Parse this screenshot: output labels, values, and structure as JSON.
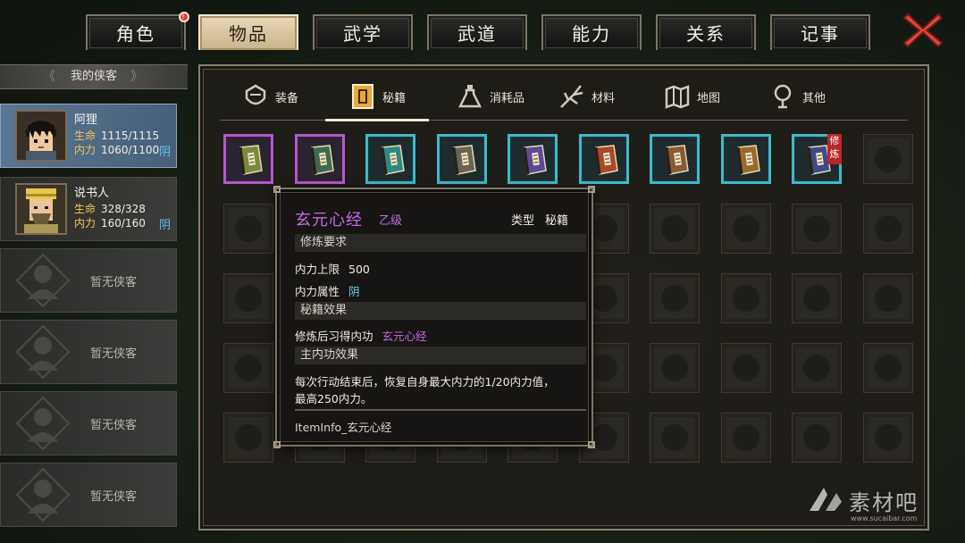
{
  "top_tabs": [
    {
      "label": "角色",
      "badge": "!"
    },
    {
      "label": "物品"
    },
    {
      "label": "武学"
    },
    {
      "label": "武道"
    },
    {
      "label": "能力"
    },
    {
      "label": "关系"
    },
    {
      "label": "记事"
    }
  ],
  "active_top_tab": "物品",
  "close_icon": "close-x-icon",
  "characters": {
    "header": "我的侠客",
    "members": [
      {
        "name": "阿狸",
        "hp_label": "生命",
        "hp": "1115/1115",
        "mp_label": "内力",
        "mp": "1060/1100",
        "attr": "阴",
        "selected": true
      },
      {
        "name": "说书人",
        "hp_label": "生命",
        "hp": "328/328",
        "mp_label": "内力",
        "mp": "160/160",
        "attr": "阴"
      }
    ],
    "empty_label": "暂无侠客",
    "empty_count": 4
  },
  "categories": [
    {
      "label": "装备",
      "icon": "equipment-icon"
    },
    {
      "label": "秘籍",
      "icon": "manual-icon"
    },
    {
      "label": "消耗品",
      "icon": "potion-icon"
    },
    {
      "label": "材料",
      "icon": "herb-icon"
    },
    {
      "label": "地图",
      "icon": "map-icon"
    },
    {
      "label": "其他",
      "icon": "misc-icon"
    }
  ],
  "active_category": "秘籍",
  "inventory": {
    "items": [
      {
        "rarity": "purple",
        "book_color": "#7a8a3c"
      },
      {
        "rarity": "purple",
        "book_color": "#3c6a52"
      },
      {
        "rarity": "cyan",
        "book_color": "#2a8a86"
      },
      {
        "rarity": "cyan",
        "book_color": "#6a6458"
      },
      {
        "rarity": "cyan",
        "book_color": "#5a4a9a"
      },
      {
        "rarity": "cyan",
        "book_color": "#a8482c"
      },
      {
        "rarity": "cyan",
        "book_color": "#8a5a34"
      },
      {
        "rarity": "cyan",
        "book_color": "#9a6a2c"
      },
      {
        "rarity": "cyan",
        "book_color": "#3c4a8a",
        "tag": "修炼"
      }
    ],
    "columns": 10,
    "rows": 5
  },
  "tooltip": {
    "title": "玄元心经",
    "grade": "乙级",
    "type_label": "类型",
    "type_value": "秘籍",
    "section_requirements": "修炼要求",
    "req_max_mp_label": "内力上限",
    "req_max_mp_value": "500",
    "req_attr_label": "内力属性",
    "req_attr_value": "阴",
    "section_effect": "秘籍效果",
    "effect_label": "修炼后习得内功",
    "effect_value": "玄元心经",
    "section_main": "主内功效果",
    "main_desc_line1": "每次行动结束后，恢复自身最大内力的1/20内力值，",
    "main_desc_line2": "最高250内力。",
    "info_key": "ItemInfo_玄元心经"
  },
  "watermark": {
    "text": "素材吧",
    "sub": "www.sucaibar.com"
  },
  "colors": {
    "rarity_purple": "#b05ac8",
    "rarity_cyan": "#3fb8c8",
    "selected_slot": "#5b7692",
    "accent_purple_text": "#c06be0",
    "yin_blue": "#5fc5f0",
    "stat_label_gold": "#f3c45a"
  }
}
